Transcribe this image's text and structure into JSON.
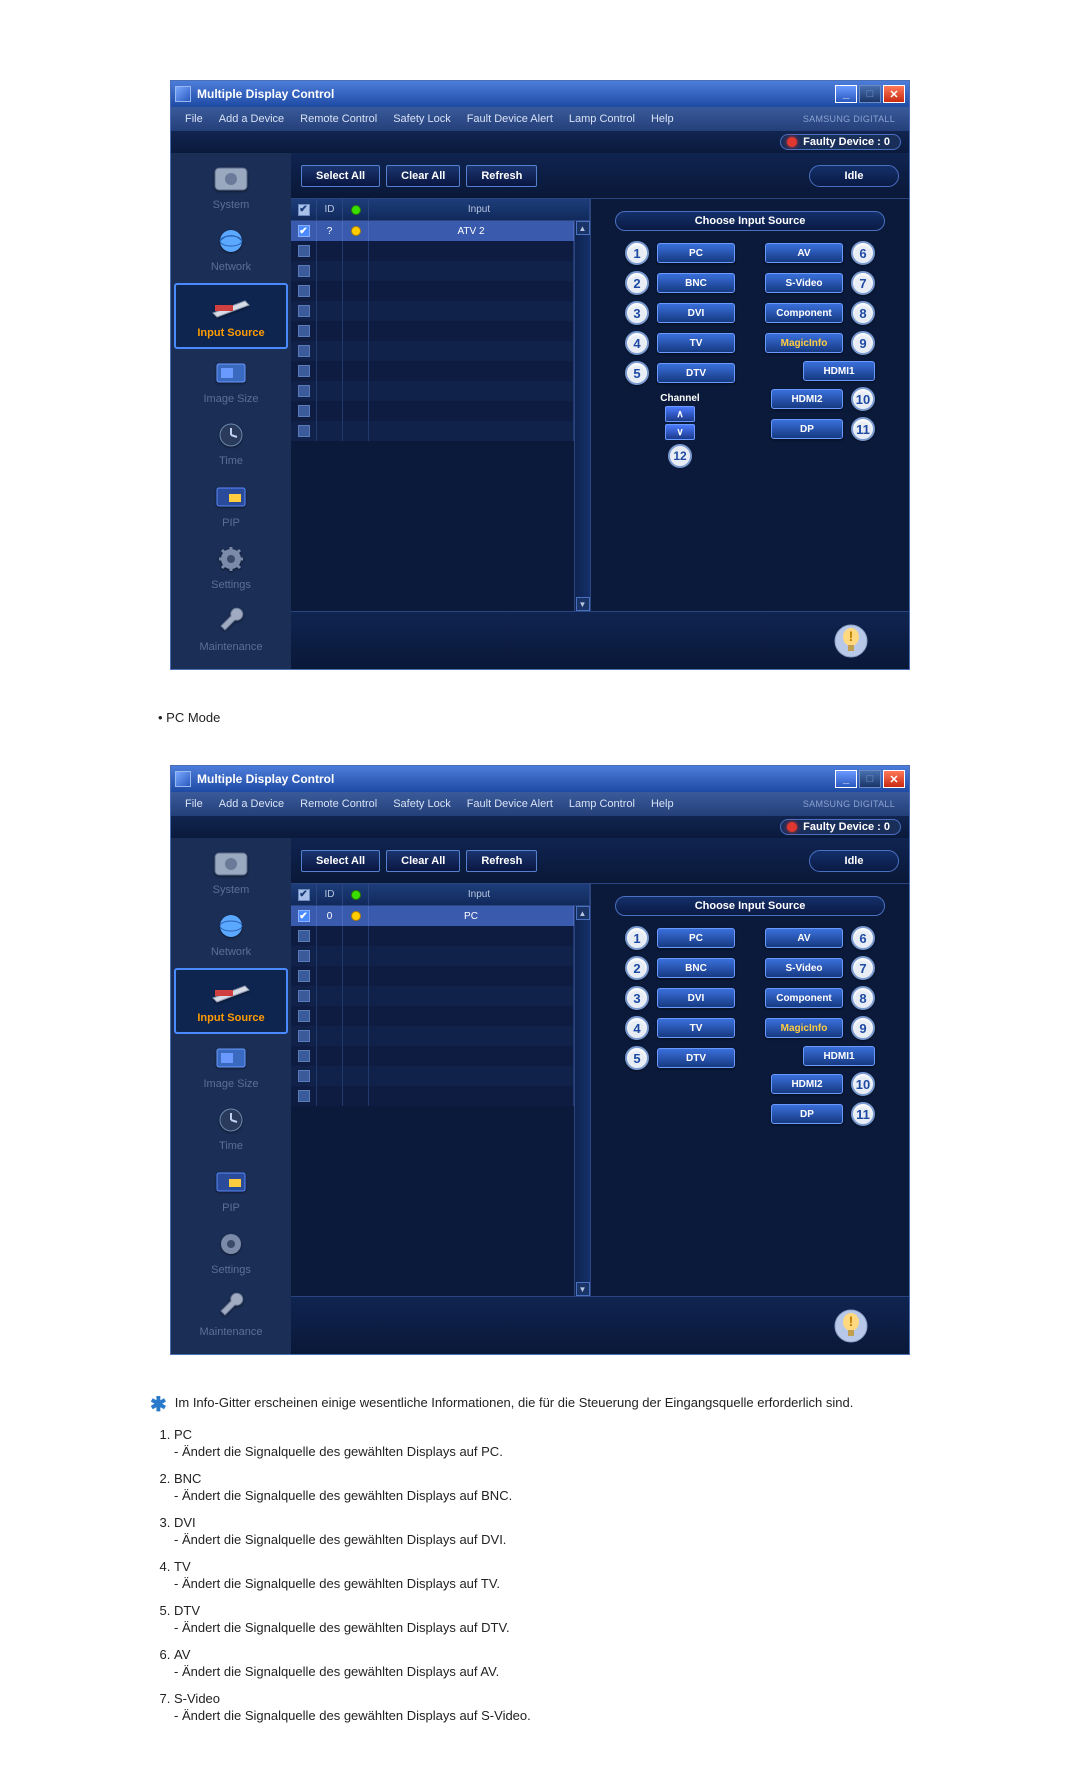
{
  "window": {
    "title": "Multiple Display Control",
    "brand": "SAMSUNG DIGITall"
  },
  "menu": {
    "file": "File",
    "add": "Add a Device",
    "remote": "Remote Control",
    "safety": "Safety Lock",
    "fault": "Fault Device Alert",
    "lamp": "Lamp Control",
    "help": "Help"
  },
  "status": {
    "faulty": "Faulty Device : 0"
  },
  "toolbar": {
    "select_all": "Select All",
    "clear_all": "Clear All",
    "refresh": "Refresh",
    "idle": "Idle"
  },
  "sidebar": {
    "items": [
      {
        "label": "System"
      },
      {
        "label": "Network"
      },
      {
        "label": "Input Source"
      },
      {
        "label": "Image Size"
      },
      {
        "label": "Time"
      },
      {
        "label": "PIP"
      },
      {
        "label": "Settings"
      },
      {
        "label": "Maintenance"
      }
    ]
  },
  "grid": {
    "headers": {
      "id": "ID",
      "input": "Input"
    },
    "row1_id_a": "?",
    "row1_input_a": "ATV 2",
    "row1_id_b": "0",
    "row1_input_b": "PC"
  },
  "source_panel": {
    "heading": "Choose Input Source",
    "left": [
      {
        "n": "1",
        "label": "PC"
      },
      {
        "n": "2",
        "label": "BNC"
      },
      {
        "n": "3",
        "label": "DVI"
      },
      {
        "n": "4",
        "label": "TV"
      },
      {
        "n": "5",
        "label": "DTV"
      }
    ],
    "right": [
      {
        "n": "6",
        "label": "AV"
      },
      {
        "n": "7",
        "label": "S-Video"
      },
      {
        "n": "8",
        "label": "Component"
      },
      {
        "n": "9",
        "label": "MagicInfo"
      },
      {
        "n": "10",
        "label": "HDMI1"
      }
    ],
    "right_extra": [
      {
        "label": "HDMI2"
      },
      {
        "n": "11",
        "label": "DP"
      }
    ],
    "channel": {
      "label": "Channel",
      "num": "12"
    }
  },
  "doc": {
    "pc_mode": "PC Mode",
    "star_note": "Im Info-Gitter erscheinen einige wesentliche Informationen, die für die Steuerung der Eingangsquelle erforderlich sind.",
    "items": [
      {
        "t": "PC",
        "d": "- Ändert die Signalquelle des gewählten Displays auf PC."
      },
      {
        "t": "BNC",
        "d": "- Ändert die Signalquelle des gewählten Displays auf BNC."
      },
      {
        "t": "DVI",
        "d": "- Ändert die Signalquelle des gewählten Displays auf DVI."
      },
      {
        "t": "TV",
        "d": "- Ändert die Signalquelle des gewählten Displays auf TV."
      },
      {
        "t": "DTV",
        "d": "- Ändert die Signalquelle des gewählten Displays auf DTV."
      },
      {
        "t": "AV",
        "d": "- Ändert die Signalquelle des gewählten Displays auf AV."
      },
      {
        "t": "S-Video",
        "d": "- Ändert die Signalquelle des gewählten Displays auf S-Video."
      }
    ]
  }
}
